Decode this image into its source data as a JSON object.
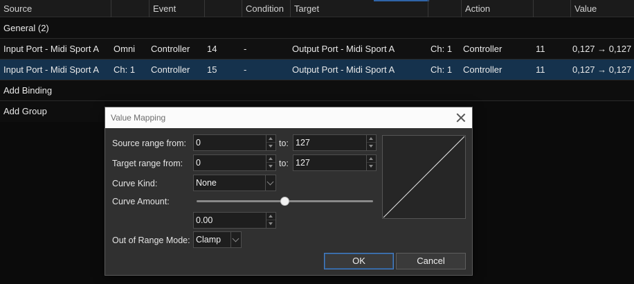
{
  "table": {
    "columns": [
      "Source",
      "",
      "Event",
      "",
      "Condition",
      "Target",
      "",
      "Action",
      "",
      "Value"
    ],
    "rows": [
      {
        "kind": "group",
        "label": "General (2)"
      },
      {
        "kind": "binding",
        "cells": [
          "Input Port - Midi Sport A",
          "Omni",
          "Controller",
          "14",
          "-",
          "Output Port - Midi Sport A",
          "Ch: 1",
          "Controller",
          "11",
          "0,127 → 0,127"
        ]
      },
      {
        "kind": "binding",
        "selected": true,
        "cells": [
          "Input Port - Midi Sport A",
          "Ch: 1",
          "Controller",
          "15",
          "-",
          "Output Port - Midi Sport A",
          "Ch: 1",
          "Controller",
          "11",
          "0,127 → 0,127"
        ]
      },
      {
        "kind": "action",
        "label": "Add Binding"
      },
      {
        "kind": "action",
        "label": "Add Group"
      }
    ]
  },
  "dialog": {
    "title": "Value Mapping",
    "source_range_label": "Source range from:",
    "source_from": "0",
    "source_to_label": "to:",
    "source_to": "127",
    "target_range_label": "Target range from:",
    "target_from": "0",
    "target_to_label": "to:",
    "target_to": "127",
    "curve_kind_label": "Curve Kind:",
    "curve_kind": "None",
    "curve_amount_label": "Curve Amount:",
    "curve_amount_value": "0.00",
    "curve_amount_fraction": 0.5,
    "out_of_range_label": "Out of Range Mode:",
    "out_of_range": "Clamp",
    "ok_label": "OK",
    "cancel_label": "Cancel"
  },
  "colors": {
    "selected_row": "#15324d",
    "accent": "#2f64a8",
    "title_bar": "#fbfbfb"
  }
}
